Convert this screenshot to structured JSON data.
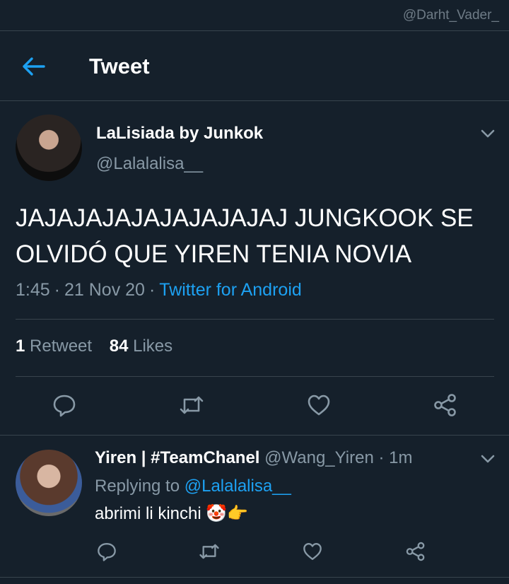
{
  "watermark": "@Darht_Vader_",
  "header": {
    "title": "Tweet"
  },
  "tweet": {
    "author_name": "LaLisiada by Junkok",
    "author_handle": "@Lalalalisa__",
    "text": "JAJAJAJAJAJAJAJAJAJ JUNGKOOK SE OLVIDÓ QUE YIREN TENIA NOVIA",
    "time": "1:45",
    "date": "21 Nov 20",
    "separator": "·",
    "source": "Twitter for Android",
    "retweets_count": "1",
    "retweets_label": "Retweet",
    "likes_count": "84",
    "likes_label": "Likes"
  },
  "reply": {
    "author_name": "Yiren | #TeamChanel",
    "author_handle": "@Wang_Yiren",
    "separator": "·",
    "time_ago": "1m",
    "replying_label": "Replying to",
    "replying_to": "@Lalalalisa__",
    "text": "abrimi li kinchi 🤡👉"
  },
  "colors": {
    "background": "#15202b",
    "accent": "#1da1f2",
    "muted": "#8899a6",
    "divider": "#38444d"
  },
  "icons": [
    "back-arrow-icon",
    "chevron-down-icon",
    "reply-icon",
    "retweet-icon",
    "like-icon",
    "share-icon"
  ]
}
